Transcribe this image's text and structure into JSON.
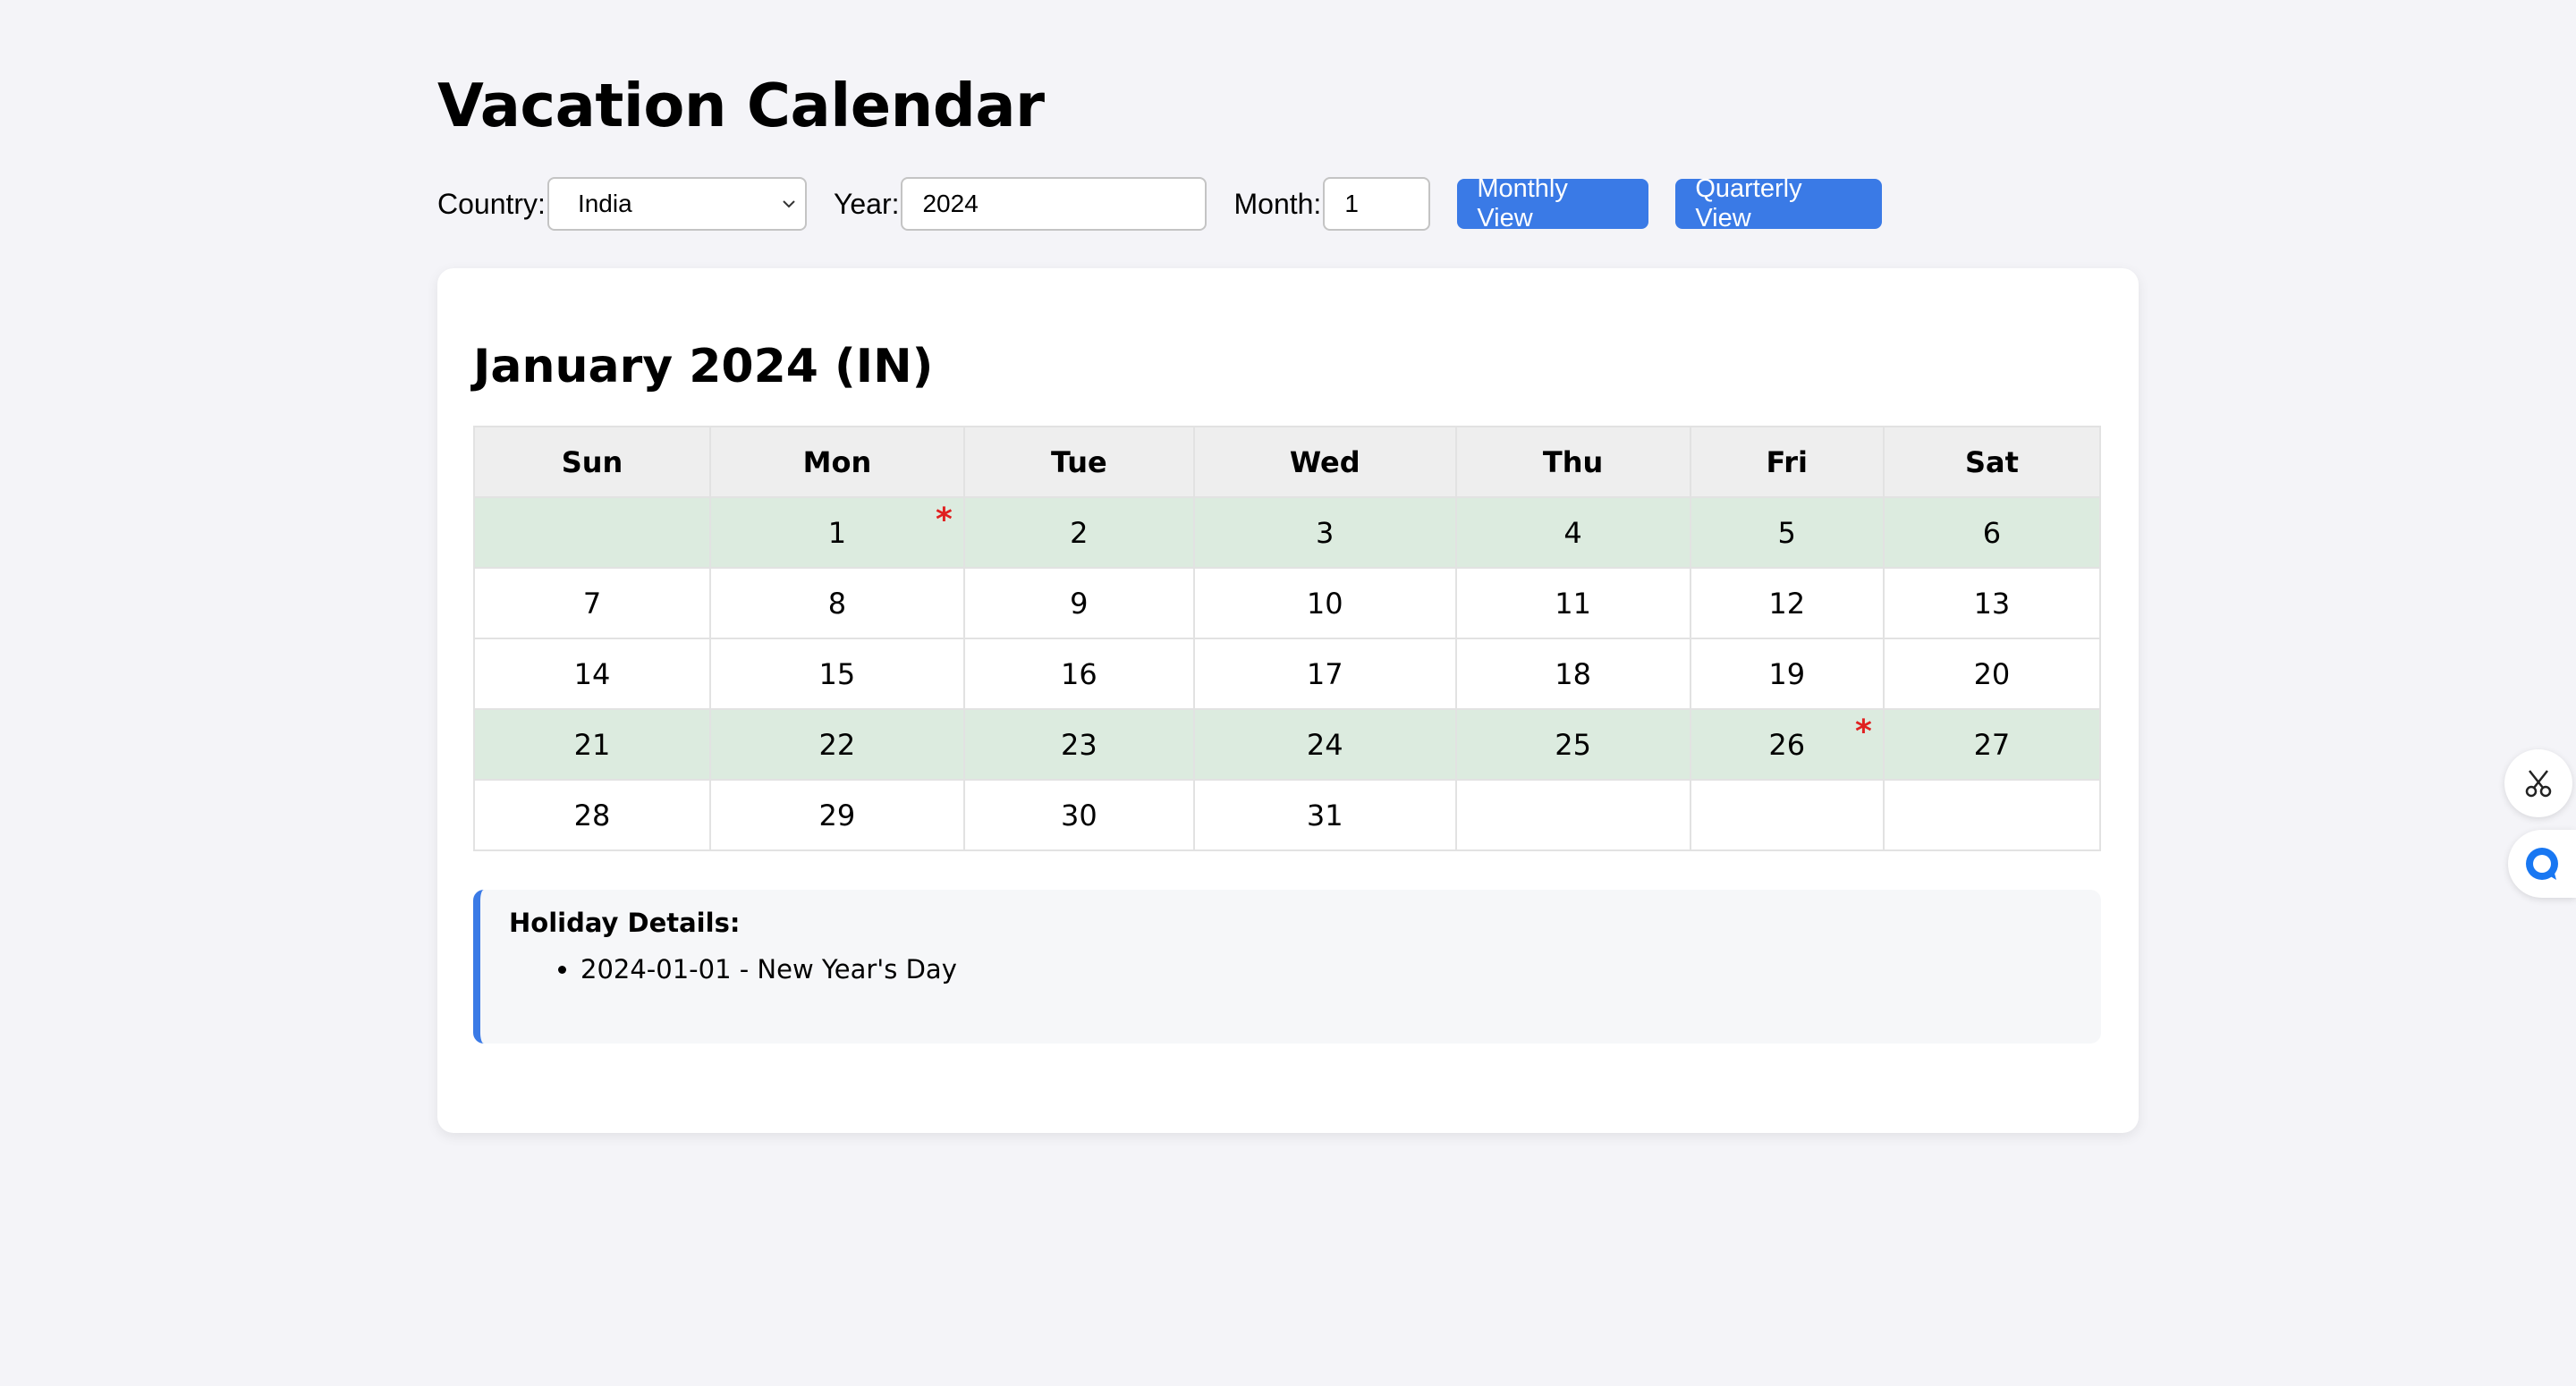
{
  "app": {
    "title": "Vacation Calendar"
  },
  "controls": {
    "country_label": "Country:",
    "country_value": "India",
    "year_label": "Year:",
    "year_value": "2024",
    "month_label": "Month:",
    "month_value": "1",
    "monthly_view_label": "Monthly View",
    "quarterly_view_label": "Quarterly View"
  },
  "calendar": {
    "title": "January 2024 (IN)",
    "weekdays": [
      "Sun",
      "Mon",
      "Tue",
      "Wed",
      "Thu",
      "Fri",
      "Sat"
    ],
    "weeks": [
      [
        "",
        "1",
        "2",
        "3",
        "4",
        "5",
        "6"
      ],
      [
        "7",
        "8",
        "9",
        "10",
        "11",
        "12",
        "13"
      ],
      [
        "14",
        "15",
        "16",
        "17",
        "18",
        "19",
        "20"
      ],
      [
        "21",
        "22",
        "23",
        "24",
        "25",
        "26",
        "27"
      ],
      [
        "28",
        "29",
        "30",
        "31",
        "",
        "",
        ""
      ]
    ],
    "highlighted_weeks": [
      0,
      3
    ],
    "holiday_marker": "*",
    "holiday_dates": [
      "1",
      "26"
    ]
  },
  "holidays": {
    "title": "Holiday Details:",
    "items": [
      "2024-01-01 - New Year's Day"
    ]
  },
  "colors": {
    "accent": "#3a7ae6",
    "highlight_week": "#dcebdf",
    "holiday_marker": "#e02020"
  },
  "side_icons": [
    "scissors-icon",
    "chat-icon"
  ]
}
